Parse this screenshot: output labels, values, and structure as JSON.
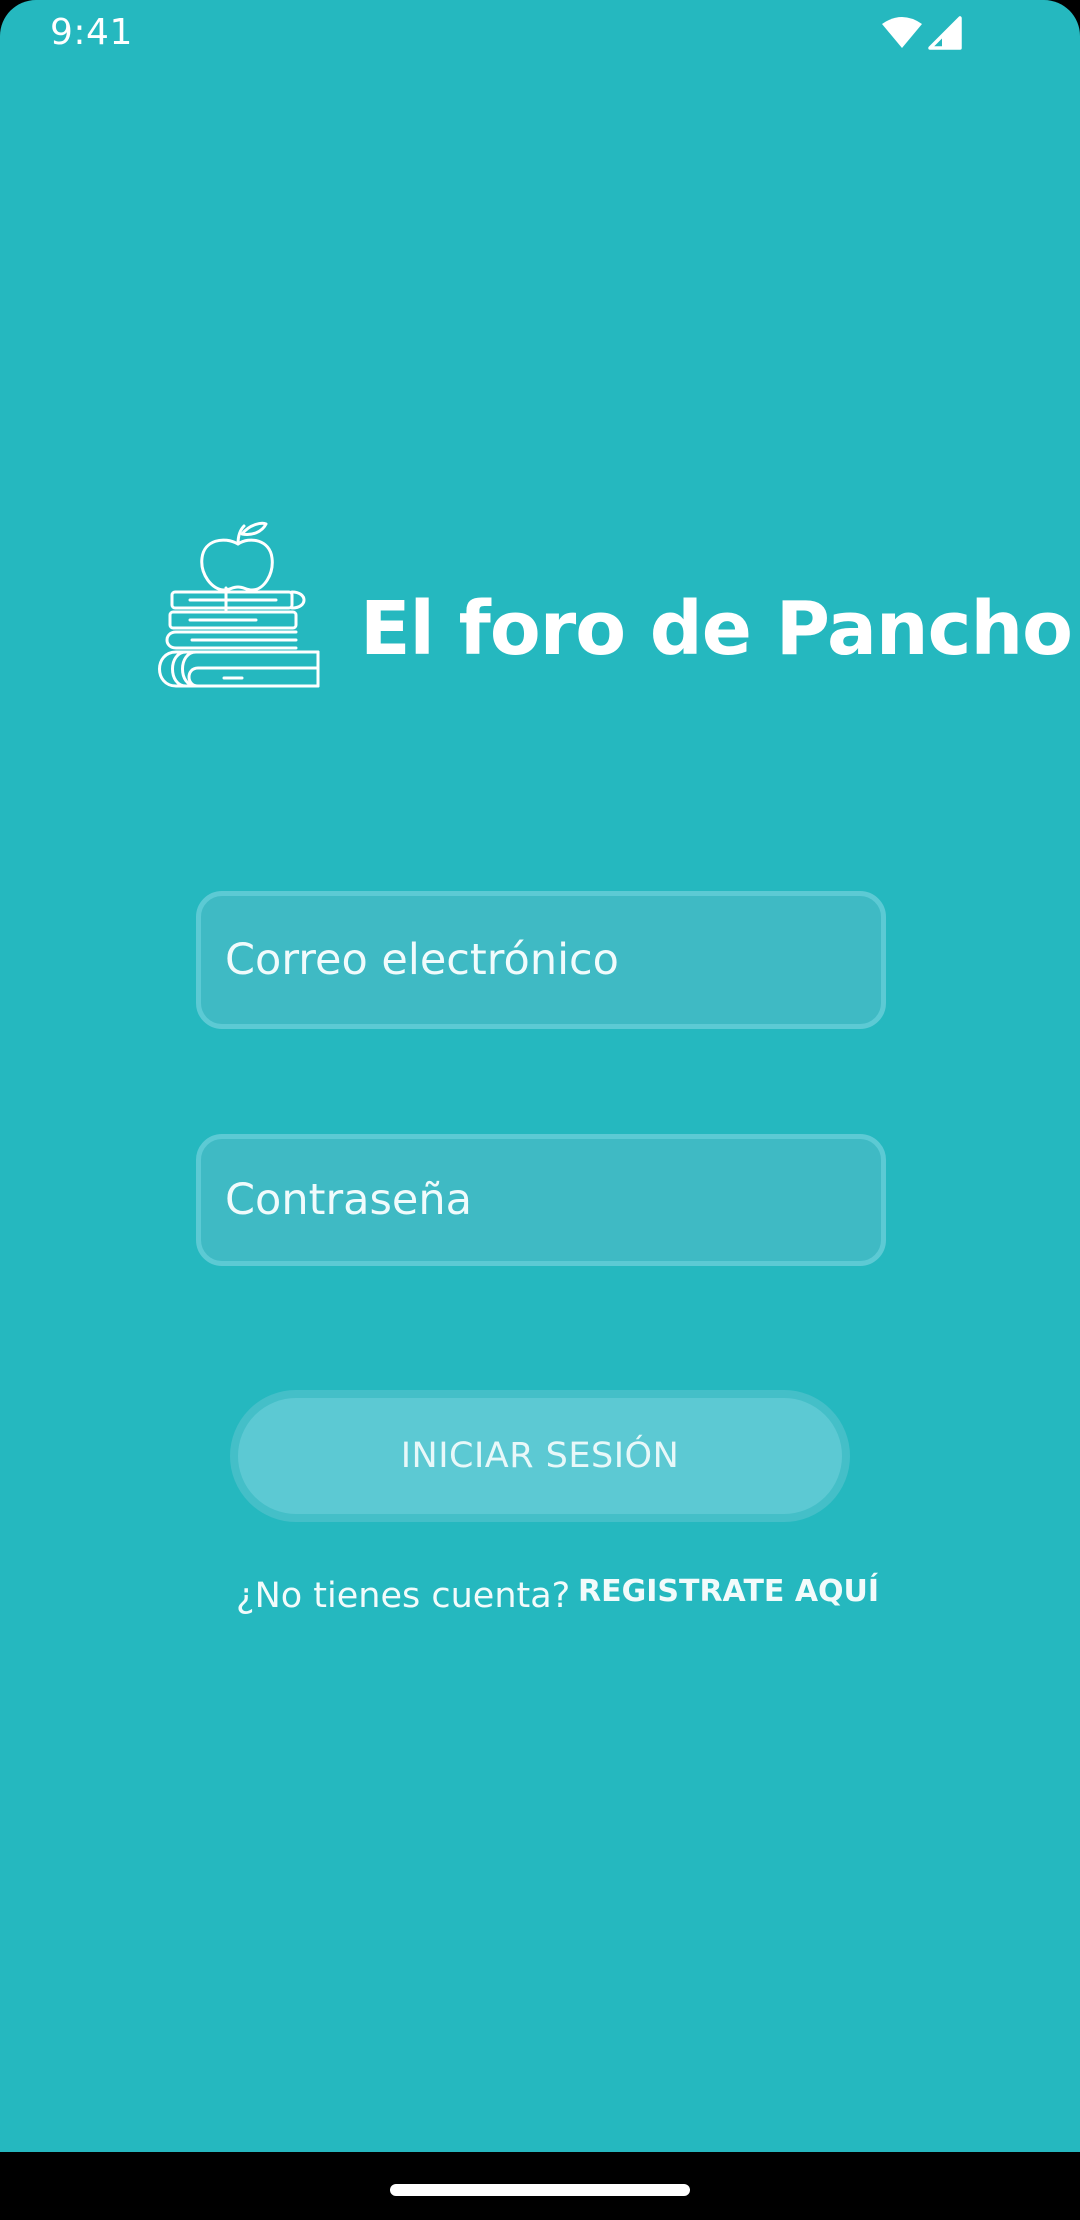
{
  "status_bar": {
    "time": "9:41",
    "icons": [
      "wifi-icon",
      "signal-icon"
    ]
  },
  "brand": {
    "logo_icon": "books-apple-icon",
    "title": "El foro de Pancho"
  },
  "form": {
    "email_placeholder": "Correo electrónico",
    "email_value": "",
    "password_placeholder": "Contraseña",
    "password_value": "",
    "submit_label": "INICIAR SESIÓN"
  },
  "signup": {
    "question": "¿No tienes cuenta?",
    "link_label": "REGISTRATE AQUÍ"
  },
  "colors": {
    "background": "#25b8bf",
    "field_fill": "#3fbac4",
    "field_border": "#5ccad4",
    "button_fill": "#5cc9d3",
    "text": "#ffffff"
  }
}
